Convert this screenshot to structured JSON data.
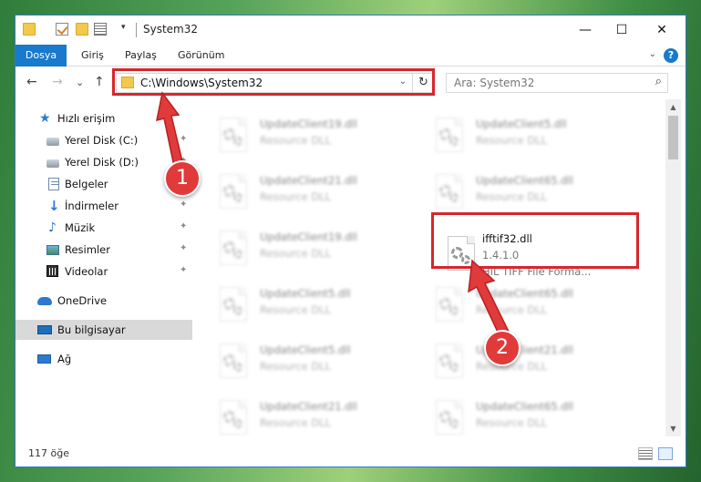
{
  "window": {
    "title": "System32",
    "controls": {
      "minimize": "—",
      "maximize": "☐",
      "close": "✕"
    },
    "qa_dropdown": "▾"
  },
  "ribbon": {
    "tabs": [
      "Dosya",
      "Giriş",
      "Paylaş",
      "Görünüm"
    ],
    "expand": "⌄",
    "help": "?"
  },
  "nav": {
    "back": "←",
    "forward": "→",
    "recent": "⌄",
    "up": "↑",
    "address": "C:\\Windows\\System32",
    "address_dropdown": "⌄",
    "refresh": "↻",
    "search_placeholder": "Ara: System32",
    "search_icon": "⌕"
  },
  "sidebar": {
    "items": [
      {
        "label": "Hızlı erişim",
        "icon": "star-icon",
        "pinned": false
      },
      {
        "label": "Yerel Disk (C:)",
        "icon": "disk-icon",
        "pinned": true
      },
      {
        "label": "Yerel Disk (D:)",
        "icon": "disk-icon",
        "pinned": true
      },
      {
        "label": "Belgeler",
        "icon": "document-icon",
        "pinned": true
      },
      {
        "label": "İndirmeler",
        "icon": "download-icon",
        "pinned": true
      },
      {
        "label": "Müzik",
        "icon": "music-icon",
        "pinned": true
      },
      {
        "label": "Resimler",
        "icon": "pictures-icon",
        "pinned": true
      },
      {
        "label": "Videolar",
        "icon": "videos-icon",
        "pinned": true
      },
      {
        "label": "OneDrive",
        "icon": "onedrive-icon",
        "pinned": false
      },
      {
        "label": "Bu bilgisayar",
        "icon": "computer-icon",
        "pinned": false
      },
      {
        "label": "Ağ",
        "icon": "network-icon",
        "pinned": false
      }
    ],
    "pin_glyph": "✦"
  },
  "files": [
    {
      "name": "UpdateClient19.dll",
      "type": "Resource DLL"
    },
    {
      "name": "UpdateClient5.dll",
      "type": "Resource DLL"
    },
    {
      "name": "UpdateClient21.dll",
      "type": "Resource DLL"
    },
    {
      "name": "UpdateClient65.dll",
      "type": "Resource DLL"
    },
    {
      "name": "UpdateClient19.dll",
      "type": "Resource DLL"
    },
    {
      "name": "ifftif32.dll",
      "version": "1.4.1.0",
      "description": "HIL TIFF File Forma..."
    },
    {
      "name": "UpdateClient5.dll",
      "type": "Resource DLL"
    },
    {
      "name": "UpdateClient65.dll",
      "type": "Resource DLL"
    },
    {
      "name": "UpdateClient5.dll",
      "type": "Resource DLL"
    },
    {
      "name": "UpdateClient21.dll",
      "type": "Resource DLL"
    },
    {
      "name": "UpdateClient21.dll",
      "type": "Resource DLL"
    },
    {
      "name": "UpdateClient65.dll",
      "type": "Resource DLL"
    }
  ],
  "status": {
    "item_count": "117 öğe"
  },
  "scrollbar": {
    "up": "▲",
    "down": "▼"
  },
  "annotations": {
    "step1": "1",
    "step2": "2",
    "highlight_color": "#d7262b",
    "badge_color": "#e03a3a"
  },
  "colors": {
    "accent": "#1979ca",
    "selection": "#cce8ff"
  }
}
